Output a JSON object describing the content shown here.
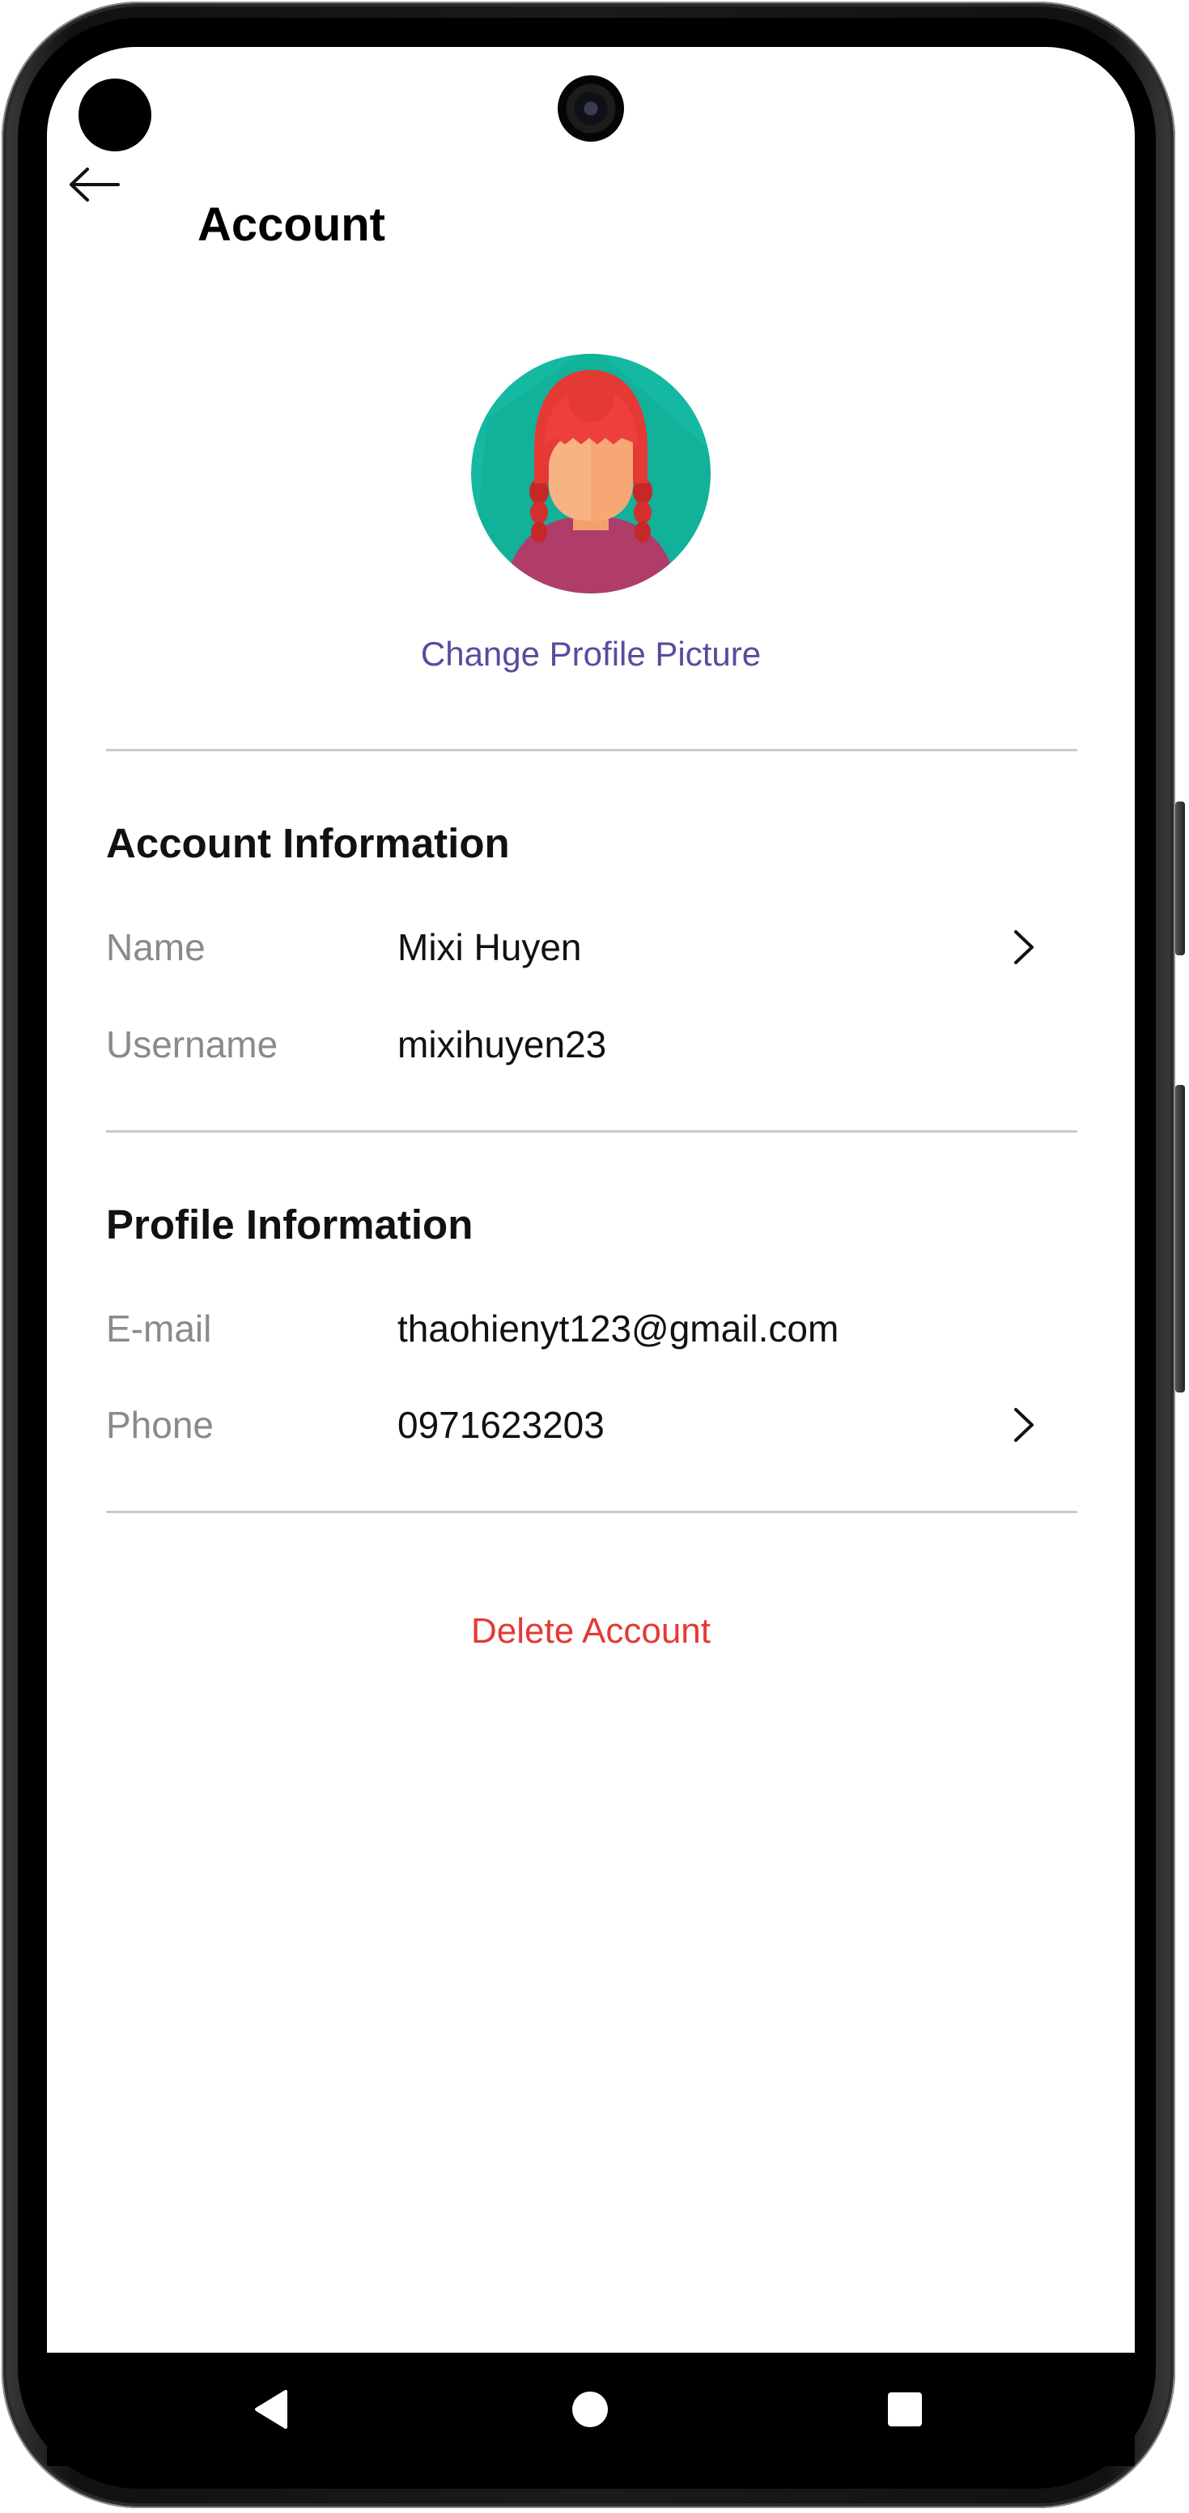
{
  "header": {
    "title": "Account",
    "back_icon": "arrow-left-icon"
  },
  "profile": {
    "avatar_icon": "avatar-girl-red-hair",
    "change_picture_label": "Change Profile Picture"
  },
  "account_section": {
    "title": "Account Information",
    "rows": [
      {
        "label": "Name",
        "value": "Mixi Huyen",
        "chevron": true
      },
      {
        "label": "Username",
        "value": "mixihuyen23",
        "chevron": false
      }
    ]
  },
  "profile_section": {
    "title": "Profile Information",
    "rows": [
      {
        "label": "E-mail",
        "value": "thaohienyt123@gmail.com",
        "chevron": false
      },
      {
        "label": "Phone",
        "value": "0971623203",
        "chevron": true
      }
    ]
  },
  "actions": {
    "delete_label": "Delete Account"
  },
  "system_nav": {
    "back_icon": "triangle-back-icon",
    "home_icon": "circle-home-icon",
    "recents_icon": "square-recents-icon"
  },
  "colors": {
    "accent": "#5b4a9e",
    "danger": "#e53935",
    "divider": "#c9c9d3",
    "label_gray": "#8a8a8a"
  }
}
